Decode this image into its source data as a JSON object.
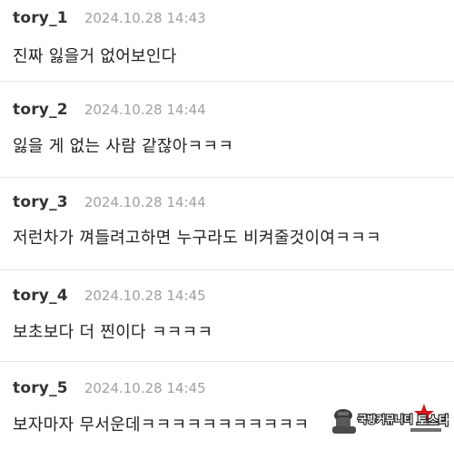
{
  "comments": [
    {
      "author": "tory_1",
      "timestamp": "2024.10.28 14:43",
      "text": "진짜 잃을거 없어보인다"
    },
    {
      "author": "tory_2",
      "timestamp": "2024.10.28 14:44",
      "text": "잃을 게 없는 사람 같잖아ㅋㅋㅋ"
    },
    {
      "author": "tory_3",
      "timestamp": "2024.10.28 14:44",
      "text": "저런차가 껴들려고하면 누구라도 비켜줄것이여ㅋㅋㅋ"
    },
    {
      "author": "tory_4",
      "timestamp": "2024.10.28 14:45",
      "text": "보초보다 더 찐이다 ㅋㅋㅋㅋ"
    },
    {
      "author": "tory_5",
      "timestamp": "2024.10.28 14:45",
      "text": "보자마자 무서운데ㅋㅋㅋㅋㅋㅋㅋㅋㅋㅋㅋ"
    }
  ],
  "watermark": {
    "text": "국방커뮤니티 토스타",
    "icon": "star-icon",
    "star_color": "#d4161c"
  }
}
